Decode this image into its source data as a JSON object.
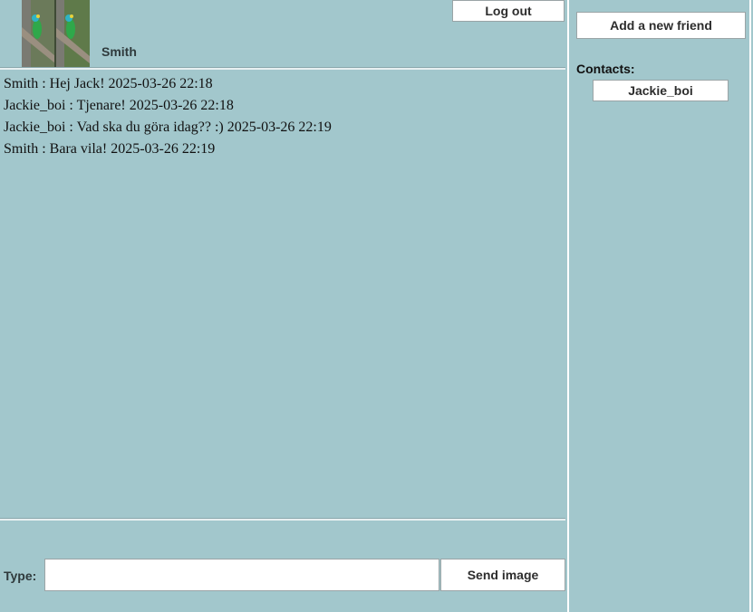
{
  "header": {
    "username": "Smith",
    "logout_label": "Log out"
  },
  "messages": [
    {
      "text": "Smith : Hej Jack! 2025-03-26 22:18"
    },
    {
      "text": "Jackie_boi : Tjenare! 2025-03-26 22:18"
    },
    {
      "text": "Jackie_boi : Vad ska du göra idag?? :) 2025-03-26 22:19"
    },
    {
      "text": "Smith : Bara vila! 2025-03-26 22:19"
    }
  ],
  "composer": {
    "type_label": "Type:",
    "input_value": "",
    "send_image_label": "Send image"
  },
  "sidebar": {
    "add_friend_label": "Add a new friend",
    "contacts_label": "Contacts:",
    "contacts": [
      {
        "name": "Jackie_boi"
      }
    ]
  },
  "colors": {
    "background": "#a2c7cc",
    "button_bg": "#ffffff"
  }
}
